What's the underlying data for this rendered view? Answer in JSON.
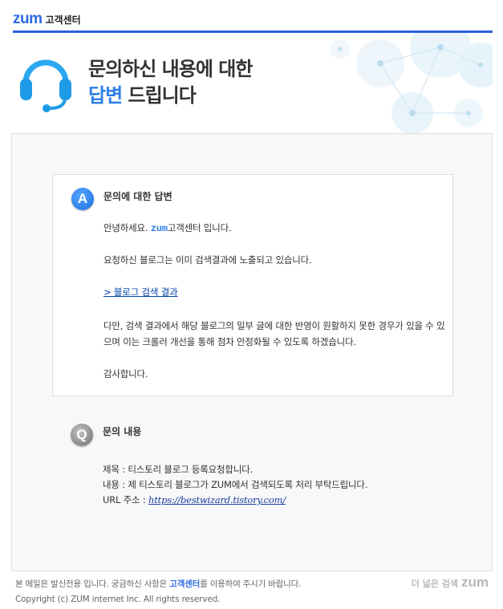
{
  "header": {
    "logo_text": "zum",
    "logo_sub": "고객센터"
  },
  "hero": {
    "title_line1": "문의하신 내용에 대한",
    "title_line2_highlight": "답변",
    "title_line2_rest": " 드립니다"
  },
  "answer": {
    "badge": "A",
    "title": "문의에 대한 답변",
    "greeting_pre": "안녕하세요. ",
    "greeting_brand": "zum",
    "greeting_post": "고객센터 입니다.",
    "line_indexed": "요청하신 블로그는 이미 검색결과에 노출되고 있습니다.",
    "link_label": "> 블로그 검색 결과",
    "notice": "다만, 검색 결과에서 해당 블로그의 일부 글에 대한 반영이 원활하지 못한 경우가 있을 수 있으며 이는 크롤러 개선을 통해 점차 안정화될 수 있도록 하겠습니다.",
    "thanks": "감사합니다."
  },
  "inquiry": {
    "badge": "Q",
    "title": "문의 내용",
    "subject_line": "제목 : 티스토리 블로그 등록요청합니다.",
    "content_line": "내용 : 제 티스토리 블로그가 ZUM에서 검색되도록 처리 부탁드립니다.",
    "url_label": "URL 주소 : ",
    "url_value": "https://bestwizard.tistory.com/"
  },
  "footer": {
    "notice_pre": "본 메일은 발신전용 입니다. 궁금하신 사항은 ",
    "notice_link": "고객센터",
    "notice_post": "를 이용하여 주시기 바랍니다.",
    "copyright": "Copyright (c) ZUM internet Inc. All rights reserved.",
    "brand_tagline": "더 넓은 검색",
    "brand_logo": "zum"
  },
  "colors": {
    "accent": "#2d5fdb",
    "brand_blue": "#2d7fe6",
    "panel_bg": "#f7f8fa"
  },
  "icons": [
    "headset-icon",
    "answer-badge-icon",
    "question-badge-icon"
  ]
}
